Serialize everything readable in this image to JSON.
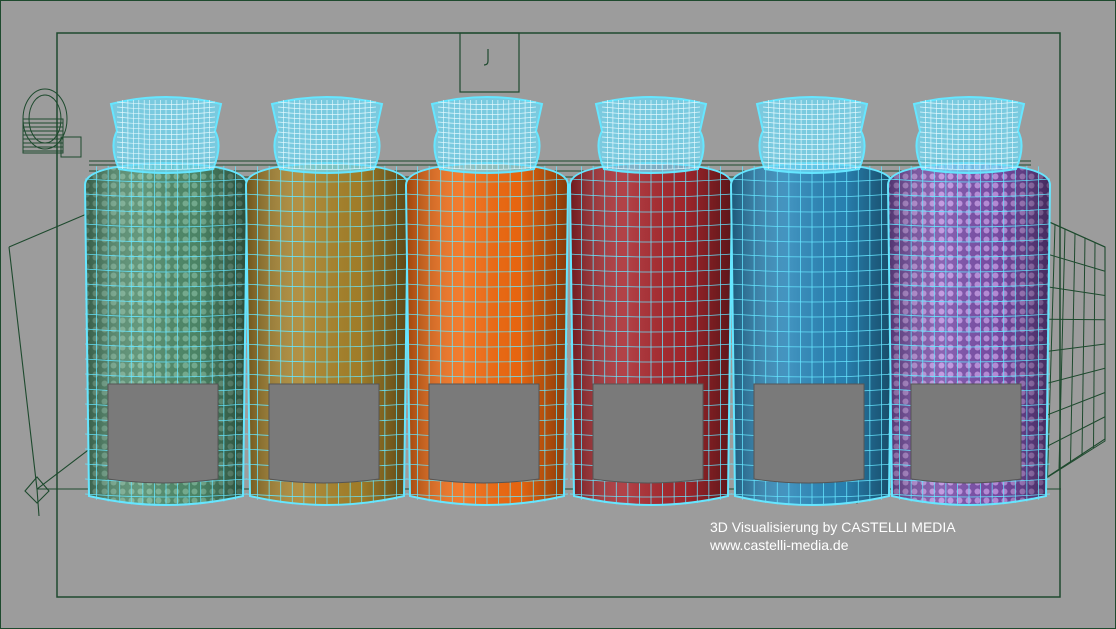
{
  "viewport": {
    "background": "#9c9c9c",
    "wireframe_color": "#1e4a2e",
    "selection_color": "#66e6ff"
  },
  "bottles": [
    {
      "name": "bottle-green-speckled",
      "color": "#4f8a6a",
      "pattern": "dots",
      "pattern_color": "#7fb89a"
    },
    {
      "name": "bottle-gold",
      "color": "#a8832a",
      "pattern": "none",
      "pattern_color": ""
    },
    {
      "name": "bottle-orange",
      "color": "#f26a10",
      "pattern": "none",
      "pattern_color": ""
    },
    {
      "name": "bottle-red",
      "color": "#a8282e",
      "pattern": "none",
      "pattern_color": ""
    },
    {
      "name": "bottle-blue",
      "color": "#2a86b8",
      "pattern": "none",
      "pattern_color": ""
    },
    {
      "name": "bottle-purple-speckled",
      "color": "#7a4ea8",
      "pattern": "dots",
      "pattern_color": "#c79ae8"
    }
  ],
  "label_panel_color": "#7a7a7a",
  "scene_objects": [
    "camera-icon",
    "light-icon",
    "backdrop-grid"
  ],
  "credit": {
    "line1": "3D Visualisierung by CASTELLI MEDIA",
    "line2": "www.castelli-media.de"
  }
}
